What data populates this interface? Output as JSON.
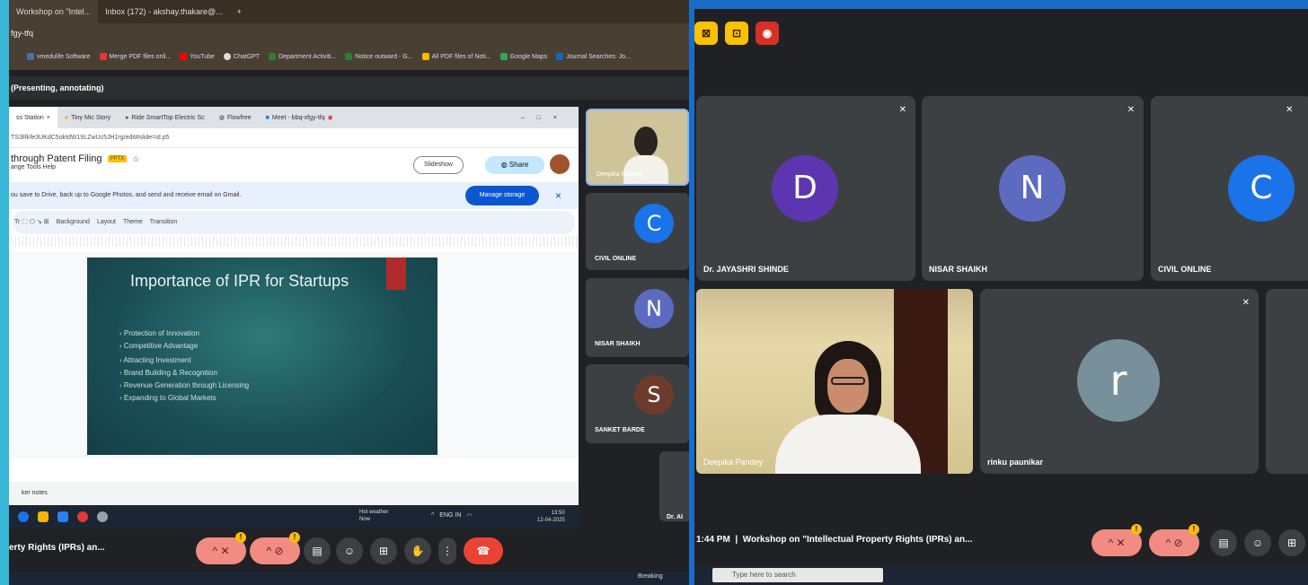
{
  "left": {
    "browser_tabs": [
      "Workshop on \"Intel...",
      "Inbox (172) - akshay.thakare@...",
      "+"
    ],
    "url": "fgy-tfq",
    "bookmarks": [
      "vmedulife Software",
      "Merge PDF files onli...",
      "YouTube",
      "ChatGPT",
      "Department Activiti...",
      "Notice outward - G...",
      "All PDF files of Noti...",
      "Google Maps",
      "Journal Searches: Jo..."
    ],
    "presenting_label": "(Presenting, annotating)",
    "chrome_tabs": [
      "ss Station",
      "Tiny Mic Story",
      "Ride SmartTop Electric Sc",
      "Flowfree",
      "Meet - bbq-xfgy-tfq"
    ],
    "doc_url": "TS3Rkfe3UKdC5oktdW19LZwUc5JH1rg/edit#slide=id.p5",
    "doc_title": "through Patent Filing",
    "doc_badge": "PPTX",
    "doc_menu": "ange   Tools   Help",
    "slideshow_label": "Slideshow",
    "share_label": "Share",
    "banner_text": "ou save to Drive, back up to Google Photos, and send and receive email on Gmail.",
    "manage_storage_label": "Manage storage",
    "toolbar_items": [
      "Background",
      "Layout",
      "Theme",
      "Transition"
    ],
    "slide": {
      "title": "Importance of IPR for Startups",
      "bullets": [
        "Protection of Innovation",
        "Competitive Advantage",
        "Attracting Investment",
        "Brand Building & Recognition",
        "Revenue Generation through Licensing",
        "Expanding to Global Markets"
      ]
    },
    "notes_label": "ker notes",
    "weather": {
      "line1": "Hot weather",
      "line2": "Now"
    },
    "lang": "ENG IN",
    "clock": {
      "time": "13:50",
      "date": "12-04-2025"
    },
    "side_tiles": [
      {
        "name": "Deepika Pandey",
        "type": "video"
      },
      {
        "name": "CIVIL ONLINE",
        "initial": "C",
        "color": "#1a73e8"
      },
      {
        "name": "NISAR SHAIKH",
        "initial": "N",
        "color": "#5c6bc0"
      },
      {
        "name": "SANKET BARDE",
        "initial": "S",
        "color": "#6d3b2b"
      }
    ],
    "partial_tile_name": "Dr. AI",
    "meeting_title": "erty Rights (IPRs) an...",
    "breaking_label": "Breaking"
  },
  "right": {
    "participants_top": [
      {
        "name": "Dr. JAYASHRI SHINDE",
        "initial": "D",
        "color": "#5e35b1"
      },
      {
        "name": "NISAR SHAIKH",
        "initial": "N",
        "color": "#5c6bc0"
      },
      {
        "name": "CIVIL ONLINE",
        "initial": "C",
        "color": "#1a73e8"
      }
    ],
    "participants_bottom": [
      {
        "name": "Deepika Pandey",
        "type": "video"
      },
      {
        "name": "rinku paunikar",
        "initial": "r",
        "color": "#78909c"
      }
    ],
    "meeting_time": "1:44 PM",
    "meeting_title": "Workshop on \"Intellectual Property Rights (IPRs) an...",
    "search_placeholder": "Type here to search"
  },
  "colors": {
    "accent_blue": "#1b6cc9",
    "meet_dark": "#202124",
    "tile": "#3c4043",
    "end_call": "#ea4335",
    "warn": "#fbbc04"
  }
}
